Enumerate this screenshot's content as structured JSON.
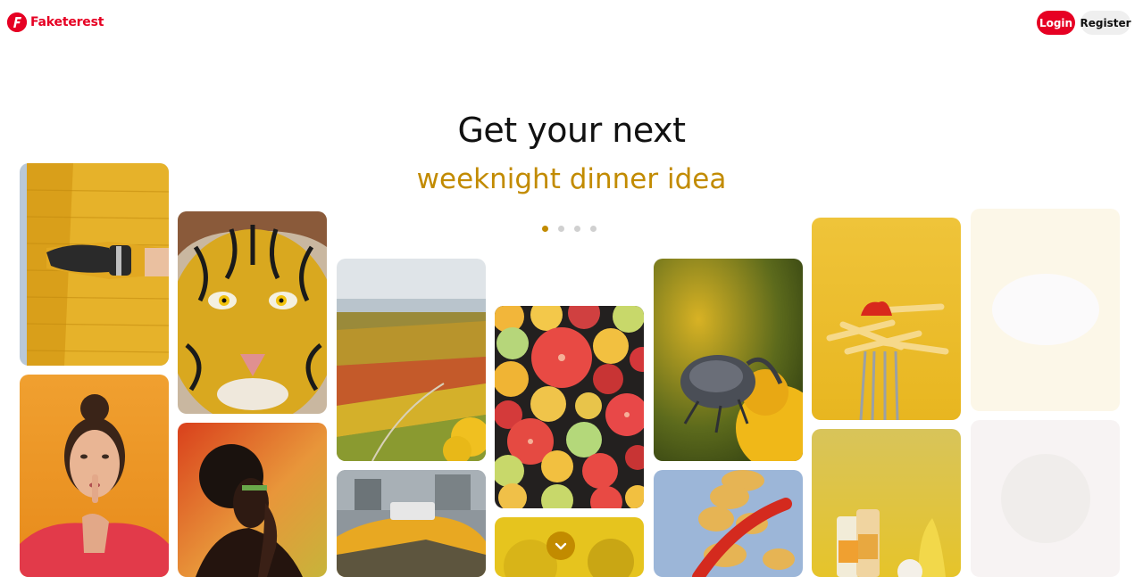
{
  "header": {
    "brand": "Faketerest",
    "login_label": "Login",
    "register_label": "Register"
  },
  "hero": {
    "title": "Get your next",
    "subtitle": "weeknight dinner idea",
    "accent_color": "#c28b00",
    "carousel_total": 4,
    "carousel_active": 1
  },
  "colors": {
    "brand": "#e60023",
    "register_bg": "#efefef"
  },
  "icons": {
    "logo": "faketerest-logo-icon",
    "scroll": "chevron-down-icon"
  },
  "images": [
    "yellow-sweater-robot-hand",
    "tiger-painting",
    "vineyard-landscape",
    "citrus-slices",
    "weevil-on-flower",
    "fries-on-fork",
    "woman-shush-gesture",
    "woman-silhouette-orange",
    "yellow-taxi",
    "yellow-flowers",
    "chips-and-chili",
    "bottles-and-banana",
    "faded-pin-1",
    "faded-pin-2"
  ]
}
